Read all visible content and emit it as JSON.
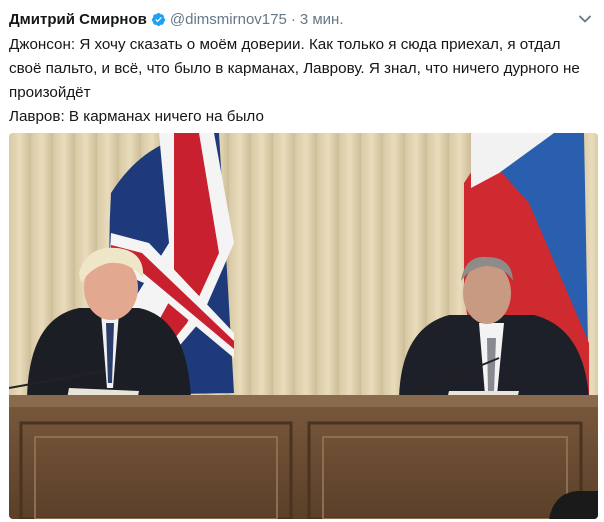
{
  "tweet": {
    "author_name": "Дмитрий Смирнов",
    "handle": "@dimsmirnov175",
    "time": "3 мин.",
    "separator": "·",
    "lines": [
      "Джонсон: Я хочу сказать о моём доверии. Как только я сюда приехал, я отдал своё пальто, и всё, что было в карманах, Лаврову. Я знал, что ничего дурного не произойдёт",
      "Лавров: В карманах ничего на было"
    ]
  },
  "icons": {
    "verified": "verified-badge-icon",
    "caret": "chevron-down-icon"
  },
  "colors": {
    "name": "#14171a",
    "secondary": "#657786",
    "verified": "#1da1f2"
  }
}
